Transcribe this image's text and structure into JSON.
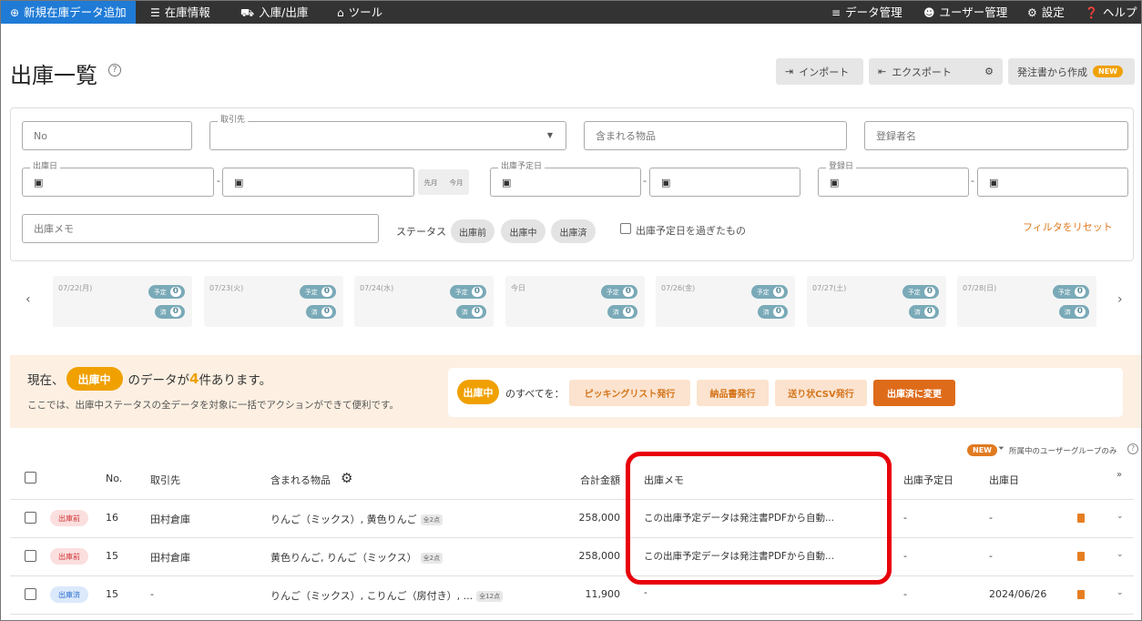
{
  "nav": {
    "new_item": "新規在庫データ追加",
    "stock_info": "在庫情報",
    "inout": "入庫/出庫",
    "tools": "ツール",
    "data_mgmt": "データ管理",
    "user_mgmt": "ユーザー管理",
    "settings": "設定",
    "help": "ヘルプ"
  },
  "page": {
    "title": "出庫一覧",
    "help_mark": "?",
    "import_label": "インポート",
    "export_label": "エクスポート",
    "create_from_po": "発注書から作成",
    "new_badge": "NEW"
  },
  "filters": {
    "no_placeholder": "No",
    "partner_label": "取引先",
    "included_items_placeholder": "含まれる物品",
    "registrant_placeholder": "登録者名",
    "ship_date_label": "出庫日",
    "last_month": "先月",
    "this_month": "今月",
    "scheduled_date_label": "出庫予定日",
    "registered_date_label": "登録日",
    "date_dash": "-",
    "memo_placeholder": "出庫メモ",
    "status_label": "ステータス",
    "status_before": "出庫前",
    "status_during": "出庫中",
    "status_done": "出庫済",
    "overdue_label": "出庫予定日を過ぎたもの",
    "reset": "フィルタをリセット"
  },
  "calendar": {
    "prev": "‹",
    "next": "›",
    "scheduled_tag": "予定",
    "done_tag": "済",
    "days": [
      {
        "label": "07/22(月)",
        "scheduled": 0,
        "done": 0
      },
      {
        "label": "07/23(火)",
        "scheduled": 0,
        "done": 0
      },
      {
        "label": "07/24(水)",
        "scheduled": 0,
        "done": 0
      },
      {
        "label": "今日",
        "scheduled": 0,
        "done": 0
      },
      {
        "label": "07/26(金)",
        "scheduled": 0,
        "done": 0
      },
      {
        "label": "07/27(土)",
        "scheduled": 0,
        "done": 0
      },
      {
        "label": "07/28(日)",
        "scheduled": 0,
        "done": 0
      }
    ]
  },
  "banner": {
    "prefix": "現在、",
    "status": "出庫中",
    "middle": "のデータが",
    "count": "4",
    "suffix": "件あります。",
    "sub": "ここでは、出庫中ステータスの全データを対象に一括でアクションができて便利です。",
    "all_label": "のすべてを：",
    "picking": "ピッキングリスト発行",
    "delivery": "納品書発行",
    "shipping_csv": "送り状CSV発行",
    "mark_done": "出庫済に変更"
  },
  "table": {
    "new_badge": "NEW",
    "group_filter": "所属中のユーザーグループのみ",
    "headers": {
      "no": "No.",
      "partner": "取引先",
      "items": "含まれる物品",
      "total": "合計金額",
      "memo": "出庫メモ",
      "scheduled": "出庫予定日",
      "shipped": "出庫日"
    },
    "rows": [
      {
        "status": "出庫前",
        "no": "16",
        "partner": "田村倉庫",
        "items": "りんご（ミックス）, 黄色りんご",
        "count": "全2点",
        "total": "258,000",
        "memo": "この出庫予定データは発注書PDFから自動...",
        "scheduled": "-",
        "shipped": "-"
      },
      {
        "status": "出庫前",
        "no": "15",
        "partner": "田村倉庫",
        "items": "黄色りんご, りんご（ミックス）",
        "count": "全2点",
        "total": "258,000",
        "memo": "この出庫予定データは発注書PDFから自動...",
        "scheduled": "-",
        "shipped": "-"
      },
      {
        "status": "出庫済",
        "no": "15",
        "partner": "-",
        "items": "りんご（ミックス）, こりんご（房付き）, ...",
        "count": "全12点",
        "total": "11,900",
        "memo": "-",
        "scheduled": "-",
        "shipped": "2024/06/26"
      }
    ]
  },
  "colors": {
    "nav_bg": "#333333",
    "nav_active": "#1f7bd6",
    "accent_orange": "#f0a000",
    "highlight_red": "#e8000b"
  }
}
